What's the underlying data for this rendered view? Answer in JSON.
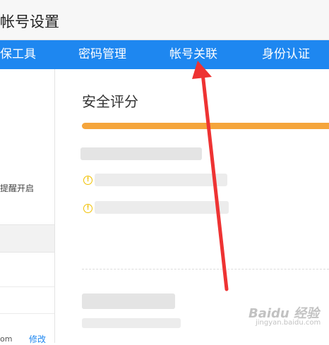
{
  "header": {
    "title": "帐号设置"
  },
  "tabs": [
    {
      "label": "保工具"
    },
    {
      "label": "密码管理"
    },
    {
      "label": "帐号关联"
    },
    {
      "label": "身份认证"
    }
  ],
  "sidebar": {
    "reminder_text": "提醒开启",
    "tail_text": "om",
    "edit_link": "修改"
  },
  "main": {
    "section_title": "安全评分",
    "score_bar_color": "#f5a53b"
  },
  "watermark": {
    "brand": "Baidu 经验",
    "sub": "jingyan.baidu.com"
  },
  "colors": {
    "tab_bar": "#1e87f0",
    "arrow": "#ee3333"
  }
}
